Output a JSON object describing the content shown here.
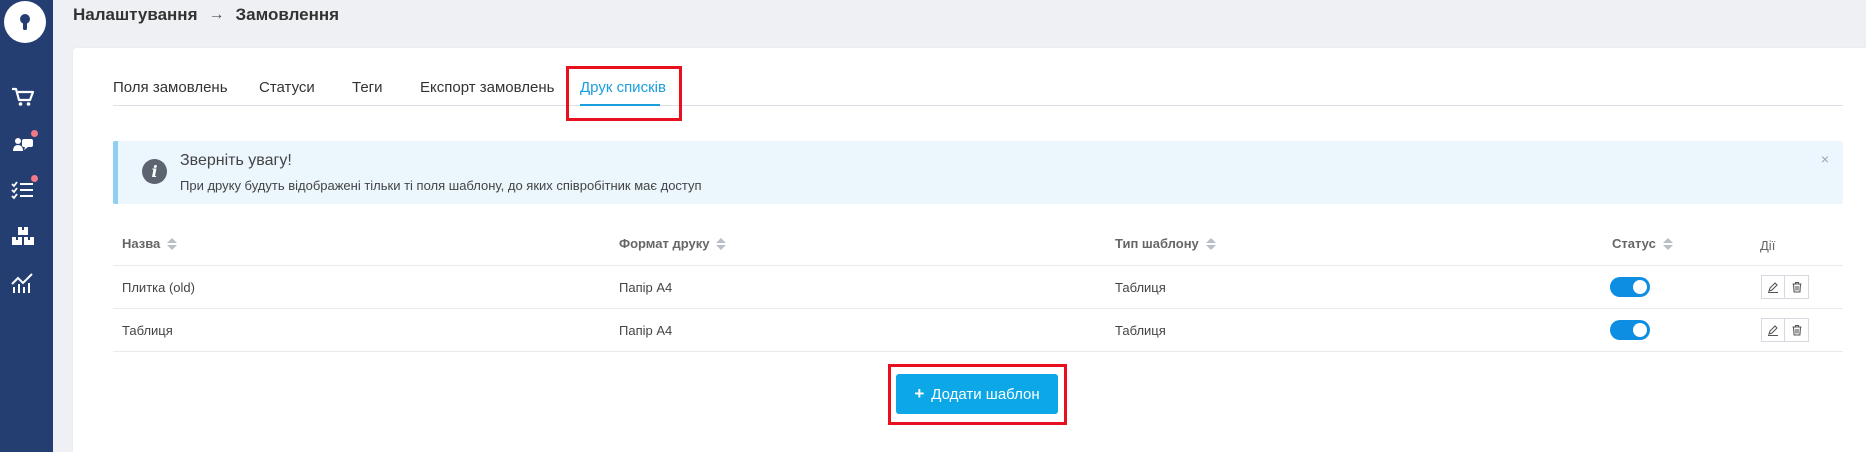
{
  "breadcrumb": {
    "parent": "Налаштування",
    "separator": "→",
    "current": "Замовлення"
  },
  "tabs": [
    {
      "label": "Поля замовлень",
      "active": false
    },
    {
      "label": "Статуси",
      "active": false
    },
    {
      "label": "Теги",
      "active": false
    },
    {
      "label": "Експорт замовлень",
      "active": false
    },
    {
      "label": "Друк списків",
      "active": true
    }
  ],
  "alert": {
    "icon": "info-icon",
    "title": "Зверніть увагу!",
    "text": "При друку будуть відображені тільки ті поля шаблону, до яких співробітник має доступ",
    "close": "×"
  },
  "table": {
    "columns": [
      "Назва",
      "Формат друку",
      "Тип шаблону",
      "Статус",
      "Дії"
    ],
    "rows": [
      {
        "name": "Плитка (old)",
        "format": "Папір А4",
        "type": "Таблиця",
        "status_enabled": true
      },
      {
        "name": "Таблиця",
        "format": "Папір А4",
        "type": "Таблиця",
        "status_enabled": true
      }
    ]
  },
  "add_button": {
    "icon": "+",
    "label": "Додати шаблон"
  },
  "sidebar": {
    "icons": [
      "cart-icon",
      "messages-icon",
      "tasks-icon",
      "warehouse-icon",
      "analytics-icon"
    ]
  },
  "colors": {
    "sidebar": "#253e72",
    "accent": "#1a9ede",
    "button": "#0ba7e6",
    "toggle": "#0d8ee3",
    "highlight": "#e8101e",
    "notification_dot": "#f27a86"
  }
}
